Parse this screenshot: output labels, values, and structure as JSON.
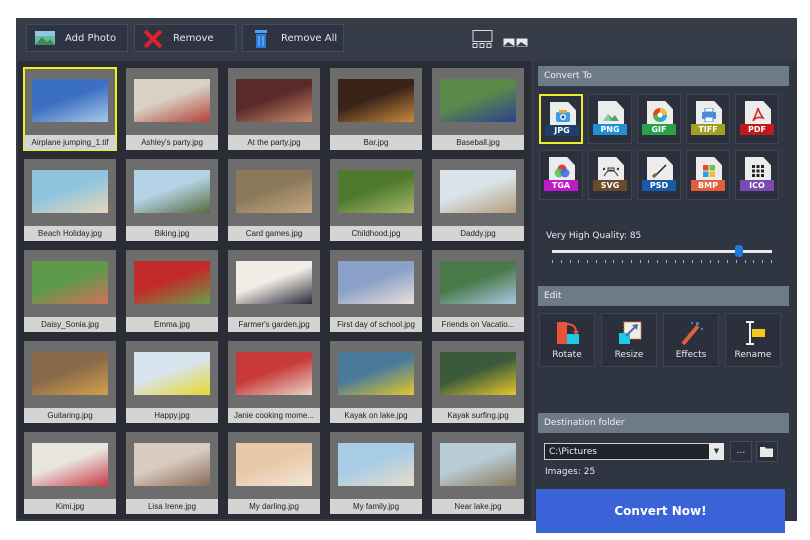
{
  "toolbar": {
    "add_photo": "Add Photo",
    "remove": "Remove",
    "remove_all": "Remove All"
  },
  "gallery": {
    "selected_index": 0,
    "items": [
      {
        "name": "Airplane jumping_1.tif",
        "colors": [
          "#3b6fc2",
          "#a9c8ea"
        ]
      },
      {
        "name": "Ashley's party.jpg",
        "colors": [
          "#d7d2c4",
          "#b5403a"
        ]
      },
      {
        "name": "At the party.jpg",
        "colors": [
          "#5a2a2a",
          "#c98a6a"
        ]
      },
      {
        "name": "Bar.jpg",
        "colors": [
          "#3a2418",
          "#c98b3e"
        ]
      },
      {
        "name": "Baseball.jpg",
        "colors": [
          "#5a8a4a",
          "#2e3f8f"
        ]
      },
      {
        "name": "Beach Holiday.jpg",
        "colors": [
          "#8fc4de",
          "#e8d6b5"
        ]
      },
      {
        "name": "Biking.jpg",
        "colors": [
          "#b5d3e6",
          "#566a3c"
        ]
      },
      {
        "name": "Card games.jpg",
        "colors": [
          "#8a7a5a",
          "#c9a582"
        ]
      },
      {
        "name": "Childhood.jpg",
        "colors": [
          "#4f7a2e",
          "#a8b86a"
        ]
      },
      {
        "name": "Daddy.jpg",
        "colors": [
          "#d9e3ea",
          "#b59b7a"
        ]
      },
      {
        "name": "Daisy_Sonia.jpg",
        "colors": [
          "#5c9a4a",
          "#d4705a"
        ]
      },
      {
        "name": "Emma.jpg",
        "colors": [
          "#c22a2a",
          "#6aa04a"
        ]
      },
      {
        "name": "Farmer's garden.jpg",
        "colors": [
          "#f2ede6",
          "#2a2a3a"
        ]
      },
      {
        "name": "First day of school.jpg",
        "colors": [
          "#8aa0c8",
          "#e8e0d8"
        ]
      },
      {
        "name": "Friends on Vacation.jpg",
        "colors": [
          "#4a7a4a",
          "#a8c8e0"
        ]
      },
      {
        "name": "Guitaring.jpg",
        "colors": [
          "#8a6a4a",
          "#d4a04a"
        ]
      },
      {
        "name": "Happy.jpg",
        "colors": [
          "#d8e4ee",
          "#e6d82a"
        ]
      },
      {
        "name": "Janie cooking moments.jpg",
        "colors": [
          "#c83a3a",
          "#e8d4c8"
        ]
      },
      {
        "name": "Kayak on lake.jpg",
        "colors": [
          "#4a7a9a",
          "#e6c82a"
        ]
      },
      {
        "name": "Kayak surfing.jpg",
        "colors": [
          "#3a5a3a",
          "#e6c82a"
        ]
      },
      {
        "name": "Kimi.jpg",
        "colors": [
          "#e8e4de",
          "#c83a4a"
        ]
      },
      {
        "name": "Lisa Irene.jpg",
        "colors": [
          "#d8ccc0",
          "#8a6a5a"
        ]
      },
      {
        "name": "My darling.jpg",
        "colors": [
          "#e8c8a8",
          "#f2e6d8"
        ]
      },
      {
        "name": "My family.jpg",
        "colors": [
          "#a8cce6",
          "#e8dcc8"
        ]
      },
      {
        "name": "Near lake.jpg",
        "colors": [
          "#b8ccd8",
          "#8a7a5a"
        ]
      }
    ],
    "captions": [
      "Airplane jumping_1.tif",
      "Ashley's party.jpg",
      "At the party.jpg",
      "Bar.jpg",
      "Baseball.jpg",
      "Beach Holiday.jpg",
      "Biking.jpg",
      "Card games.jpg",
      "Childhood.jpg",
      "Daddy.jpg",
      "Daisy_Sonia.jpg",
      "Emma.jpg",
      "Farmer's garden.jpg",
      "First day of school.jpg",
      "Friends on Vacatio...",
      "Guitaring.jpg",
      "Happy.jpg",
      "Janie cooking mome...",
      "Kayak on lake.jpg",
      "Kayak surfing.jpg",
      "Kimi.jpg",
      "Lisa Irene.jpg",
      "My darling.jpg",
      "My family.jpg",
      "Near lake.jpg"
    ]
  },
  "convert_to": {
    "header": "Convert To",
    "selected": "JPG",
    "formats": [
      {
        "label": "JPG",
        "color": "#1e3e6e",
        "icon": "camera-icon"
      },
      {
        "label": "PNG",
        "color": "#1f8fd6",
        "icon": "image-icon"
      },
      {
        "label": "GIF",
        "color": "#2aa04a",
        "icon": "color-wheel-icon"
      },
      {
        "label": "TIFF",
        "color": "#a0a020",
        "icon": "printer-icon"
      },
      {
        "label": "PDF",
        "color": "#c01a1a",
        "icon": "acrobat-icon"
      },
      {
        "label": "TGA",
        "color": "#c01ac8",
        "icon": "rgb-circles-icon"
      },
      {
        "label": "SVG",
        "color": "#6a4a2a",
        "icon": "bezier-icon"
      },
      {
        "label": "PSD",
        "color": "#1a5aa8",
        "icon": "brush-icon"
      },
      {
        "label": "BMP",
        "color": "#e0603a",
        "icon": "windows-icon"
      },
      {
        "label": "ICO",
        "color": "#7a4ab0",
        "icon": "grid-icon"
      }
    ],
    "quality_label": "Very High Quality: 85",
    "quality_value": 85,
    "quality_max": 100
  },
  "edit": {
    "header": "Edit",
    "actions": [
      "Rotate",
      "Resize",
      "Effects",
      "Rename"
    ]
  },
  "destination": {
    "header": "Destination folder",
    "path": "C:\\Pictures",
    "browse_label": "...",
    "images_count": "Images: 25"
  },
  "convert_button": "Convert Now!"
}
